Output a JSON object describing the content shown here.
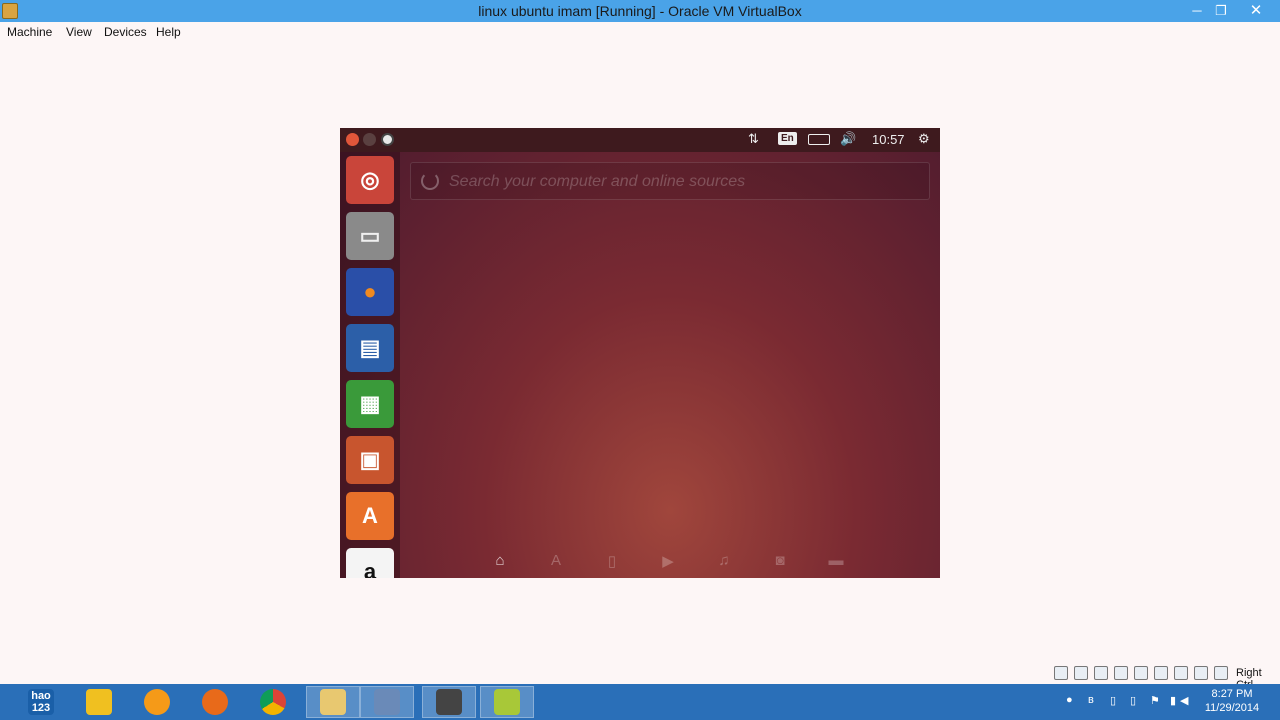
{
  "window": {
    "title": "linux ubuntu imam  [Running] - Oracle VM VirtualBox",
    "minimize": "─",
    "restore": "❐",
    "close": "✕"
  },
  "menubar": {
    "items": [
      "Machine",
      "View",
      "Devices",
      "Help"
    ]
  },
  "vm": {
    "panel": {
      "lang": "En",
      "clock": "10:57",
      "network_icon": "⇅",
      "volume_icon": "🔊",
      "settings_icon": "⚙"
    },
    "launcher": {
      "items": [
        {
          "name": "dash-home",
          "glyph": "◎",
          "bg": "#c9453a",
          "fg": "#ffffff"
        },
        {
          "name": "files",
          "glyph": "▭",
          "bg": "#8a8a8a",
          "fg": "#f0f0f0"
        },
        {
          "name": "firefox",
          "glyph": "●",
          "bg": "#2a4fa8",
          "fg": "#f08a20"
        },
        {
          "name": "libreoffice-writer",
          "glyph": "▤",
          "bg": "#2c5fa8",
          "fg": "#ffffff"
        },
        {
          "name": "libreoffice-calc",
          "glyph": "▦",
          "bg": "#3a9a3a",
          "fg": "#ffffff"
        },
        {
          "name": "libreoffice-impress",
          "glyph": "▣",
          "bg": "#c8552e",
          "fg": "#ffffff"
        },
        {
          "name": "ubuntu-software-center",
          "glyph": "A",
          "bg": "#e8702a",
          "fg": "#ffffff"
        },
        {
          "name": "amazon",
          "glyph": "a",
          "bg": "#f4f4f4",
          "fg": "#111111"
        }
      ]
    },
    "dash": {
      "search_placeholder": "Search your computer and online sources",
      "lenses": [
        {
          "name": "home",
          "glyph": "⌂"
        },
        {
          "name": "applications",
          "glyph": "A"
        },
        {
          "name": "files",
          "glyph": "▯"
        },
        {
          "name": "video",
          "glyph": "▶"
        },
        {
          "name": "music",
          "glyph": "♫"
        },
        {
          "name": "photos",
          "glyph": "◙"
        },
        {
          "name": "social",
          "glyph": "▬"
        }
      ]
    }
  },
  "vbox_status": {
    "host_key": "Right Ctrl"
  },
  "taskbar": {
    "apps": [
      {
        "name": "hao123",
        "label": "hao\n123",
        "color": "#1a5fa8"
      },
      {
        "name": "app-yellow",
        "label": "",
        "color": "#f0c020"
      },
      {
        "name": "app-orange",
        "label": "",
        "color": "#f59a18"
      },
      {
        "name": "firefox",
        "label": "",
        "color": "#e86a1a"
      },
      {
        "name": "chrome",
        "label": "",
        "color": "#3aa845"
      },
      {
        "name": "file-explorer",
        "label": "",
        "color": "#e8c870"
      },
      {
        "name": "virtualbox",
        "label": "",
        "color": "#6a8ab8"
      },
      {
        "name": "media",
        "label": "",
        "color": "#444"
      },
      {
        "name": "notes",
        "label": "",
        "color": "#a8c838"
      }
    ],
    "clock_time": "8:27 PM",
    "clock_date": "11/29/2014"
  }
}
